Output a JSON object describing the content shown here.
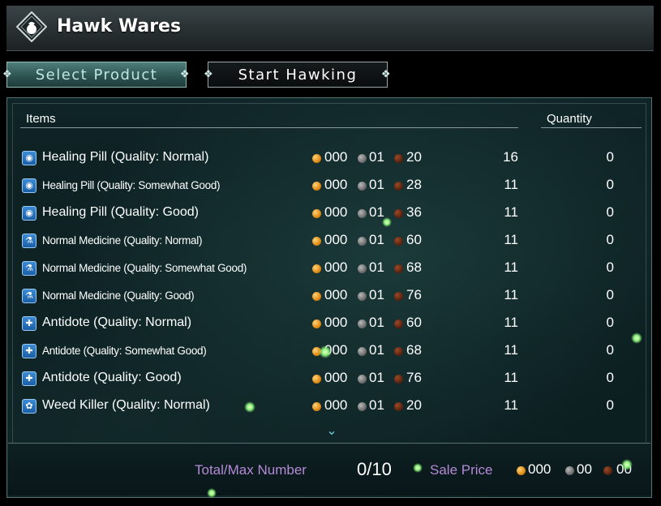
{
  "header": {
    "title": "Hawk Wares"
  },
  "tabs": [
    {
      "label": "Select Product",
      "active": true
    },
    {
      "label": "Start Hawking",
      "active": false
    }
  ],
  "table": {
    "headers": {
      "items": "Items",
      "quantity": "Quantity"
    },
    "rows": [
      {
        "name": "Healing Pill (Quality: Normal)",
        "gold": "000",
        "silver": "01",
        "copper": "20",
        "stock": "16",
        "qty": "0",
        "icon": "pill-bag-icon",
        "condensed": false
      },
      {
        "name": "Healing Pill (Quality: Somewhat Good)",
        "gold": "000",
        "silver": "01",
        "copper": "28",
        "stock": "11",
        "qty": "0",
        "icon": "pill-bag-icon",
        "condensed": true
      },
      {
        "name": "Healing Pill (Quality: Good)",
        "gold": "000",
        "silver": "01",
        "copper": "36",
        "stock": "11",
        "qty": "0",
        "icon": "pill-bag-icon",
        "condensed": false
      },
      {
        "name": "Normal Medicine (Quality: Normal)",
        "gold": "000",
        "silver": "01",
        "copper": "60",
        "stock": "11",
        "qty": "0",
        "icon": "flask-icon",
        "condensed": true
      },
      {
        "name": "Normal Medicine (Quality: Somewhat Good)",
        "gold": "000",
        "silver": "01",
        "copper": "68",
        "stock": "11",
        "qty": "0",
        "icon": "flask-icon",
        "condensed": true
      },
      {
        "name": "Normal Medicine (Quality: Good)",
        "gold": "000",
        "silver": "01",
        "copper": "76",
        "stock": "11",
        "qty": "0",
        "icon": "flask-icon",
        "condensed": true
      },
      {
        "name": "Antidote (Quality: Normal)",
        "gold": "000",
        "silver": "01",
        "copper": "60",
        "stock": "11",
        "qty": "0",
        "icon": "antidote-icon",
        "condensed": false
      },
      {
        "name": "Antidote (Quality: Somewhat Good)",
        "gold": "000",
        "silver": "01",
        "copper": "68",
        "stock": "11",
        "qty": "0",
        "icon": "antidote-icon",
        "condensed": true
      },
      {
        "name": "Antidote (Quality: Good)",
        "gold": "000",
        "silver": "01",
        "copper": "76",
        "stock": "11",
        "qty": "0",
        "icon": "antidote-icon",
        "condensed": false
      },
      {
        "name": "Weed Killer (Quality: Normal)",
        "gold": "000",
        "silver": "01",
        "copper": "20",
        "stock": "11",
        "qty": "0",
        "icon": "weed-killer-icon",
        "condensed": false
      }
    ]
  },
  "footer": {
    "total_label": "Total/Max Number",
    "total_value": "0/10",
    "price_label": "Sale Price",
    "price_gold": "000",
    "price_silver": "00",
    "price_copper": "00"
  }
}
